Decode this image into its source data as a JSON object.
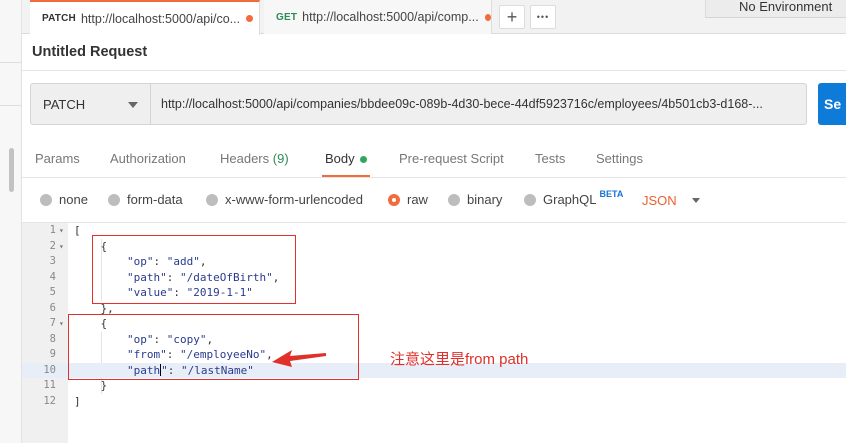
{
  "tabs": [
    {
      "method": "PATCH",
      "url": "http://localhost:5000/api/co...",
      "active": true
    },
    {
      "method": "GET",
      "url": "http://localhost:5000/api/comp...",
      "active": false
    }
  ],
  "tab_actions": {
    "add_symbol": "+",
    "more_symbol": "•••"
  },
  "environment": {
    "label": "No Environment"
  },
  "request": {
    "title": "Untitled Request",
    "method": "PATCH",
    "url": "http://localhost:5000/api/companies/bbdee09c-089b-4d30-bece-44df5923716c/employees/4b501cb3-d168-...",
    "send_label": "Se"
  },
  "request_tabs": [
    {
      "label": "Params"
    },
    {
      "label": "Authorization"
    },
    {
      "label": "Headers",
      "count": "(9)"
    },
    {
      "label": "Body",
      "active": true
    },
    {
      "label": "Pre-request Script"
    },
    {
      "label": "Tests"
    },
    {
      "label": "Settings"
    }
  ],
  "body_types": [
    {
      "label": "none",
      "selected": false
    },
    {
      "label": "form-data",
      "selected": false
    },
    {
      "label": "x-www-form-urlencoded",
      "selected": false
    },
    {
      "label": "raw",
      "selected": true
    },
    {
      "label": "binary",
      "selected": false
    },
    {
      "label": "GraphQL",
      "selected": false,
      "badge": "BETA"
    }
  ],
  "format": {
    "label": "JSON"
  },
  "code_lines": [
    {
      "n": "1",
      "fold": true,
      "text": "["
    },
    {
      "n": "2",
      "fold": true,
      "text": "    {"
    },
    {
      "n": "3",
      "text": "        \"op\": \"add\","
    },
    {
      "n": "4",
      "text": "        \"path\": \"/dateOfBirth\","
    },
    {
      "n": "5",
      "text": "        \"value\": \"2019-1-1\""
    },
    {
      "n": "6",
      "text": "    },"
    },
    {
      "n": "7",
      "fold": true,
      "text": "    {"
    },
    {
      "n": "8",
      "text": "        \"op\": \"copy\","
    },
    {
      "n": "9",
      "text": "        \"from\": \"/employeeNo\","
    },
    {
      "n": "10",
      "text": "        \"path\": \"/lastName\"",
      "highlighted": true
    },
    {
      "n": "11",
      "text": "    }"
    },
    {
      "n": "12",
      "text": "]"
    }
  ],
  "annotation": {
    "text": "注意这里是from  path",
    "color": "#e0302a"
  },
  "colors": {
    "accent": "#f26b3a",
    "send": "#0f7bd9",
    "get_method": "#2e8b57",
    "string": "#2a3a8f"
  }
}
